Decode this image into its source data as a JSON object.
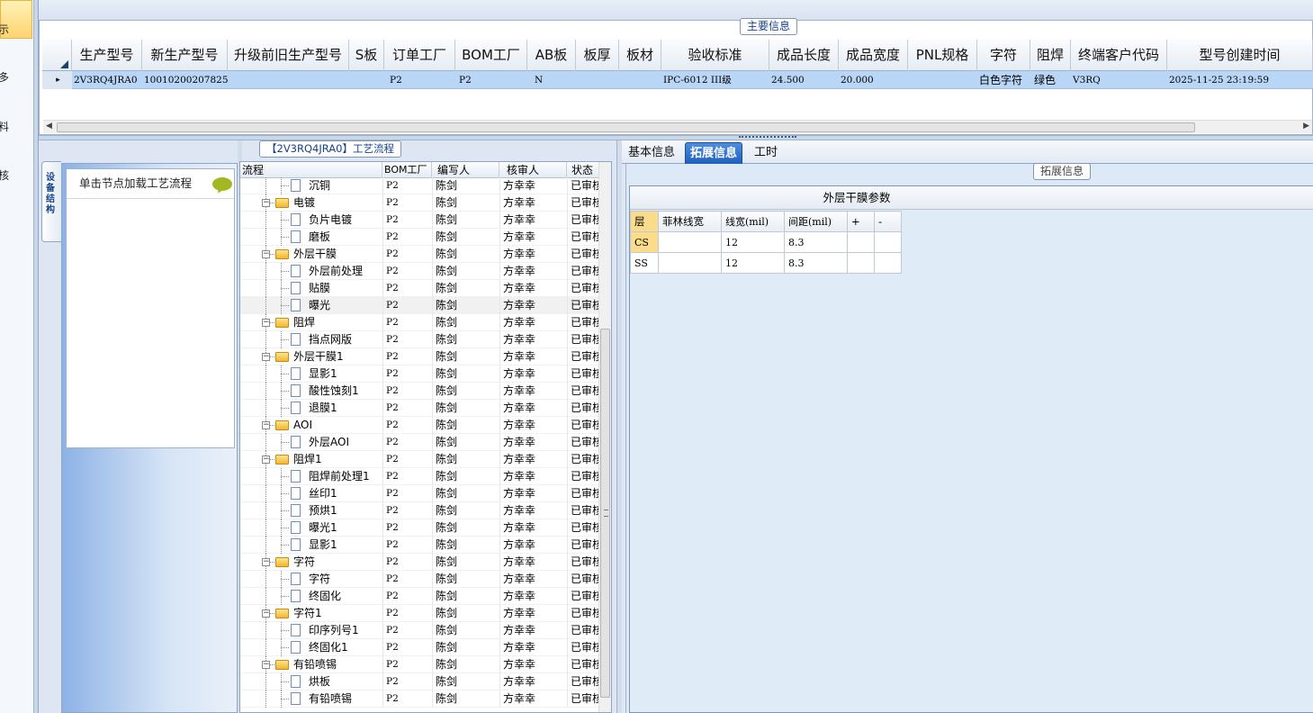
{
  "nav": {
    "items": [
      "示",
      "多",
      "料",
      "核"
    ]
  },
  "main_info": {
    "group_title": "主要信息",
    "columns": [
      "生产型号",
      "新生产型号",
      "升级前旧生产型号",
      "S板",
      "订单工厂",
      "BOM工厂",
      "AB板",
      "板厚",
      "板材",
      "验收标准",
      "成品长度",
      "成品宽度",
      "PNL规格",
      "字符",
      "阻焊",
      "终端客户代码",
      "型号创建时间"
    ],
    "row": {
      "indicator": "▸",
      "cells": [
        "2V3RQ4JRA0",
        "10010200207825",
        "",
        "",
        "P2",
        "P2",
        "N",
        "",
        "",
        "IPC-6012 III级",
        "24.500",
        "20.000",
        "",
        "白色字符",
        "绿色",
        "V3RQ",
        "2025-11-25 23:19:59"
      ]
    }
  },
  "side": {
    "tab_label": "设备结构",
    "load_hint": "单击节点加载工艺流程"
  },
  "process": {
    "group_title": "【2V3RQ4JRA0】工艺流程",
    "columns": [
      "流程",
      "BOM工厂",
      "编写人",
      "核审人",
      "状态"
    ],
    "rows": [
      {
        "name": "沉铜",
        "level": 1,
        "factory": "P2",
        "writer": "陈剑",
        "reviewer": "方幸幸",
        "status": "已审核"
      },
      {
        "name": "电镀",
        "level": 0,
        "factory": "P2",
        "writer": "陈剑",
        "reviewer": "方幸幸",
        "status": "已审核"
      },
      {
        "name": "负片电镀",
        "level": 1,
        "factory": "P2",
        "writer": "陈剑",
        "reviewer": "方幸幸",
        "status": "已审核"
      },
      {
        "name": "磨板",
        "level": 1,
        "factory": "P2",
        "writer": "陈剑",
        "reviewer": "方幸幸",
        "status": "已审核"
      },
      {
        "name": "外层干膜",
        "level": 0,
        "factory": "P2",
        "writer": "陈剑",
        "reviewer": "方幸幸",
        "status": "已审核"
      },
      {
        "name": "外层前处理",
        "level": 1,
        "factory": "P2",
        "writer": "陈剑",
        "reviewer": "方幸幸",
        "status": "已审核"
      },
      {
        "name": "贴膜",
        "level": 1,
        "factory": "P2",
        "writer": "陈剑",
        "reviewer": "方幸幸",
        "status": "已审核"
      },
      {
        "name": "曝光",
        "level": 1,
        "factory": "P2",
        "writer": "陈剑",
        "reviewer": "方幸幸",
        "status": "已审核",
        "highlight": true
      },
      {
        "name": "阻焊",
        "level": 0,
        "factory": "P2",
        "writer": "陈剑",
        "reviewer": "方幸幸",
        "status": "已审核"
      },
      {
        "name": "挡点网版",
        "level": 1,
        "factory": "P2",
        "writer": "陈剑",
        "reviewer": "方幸幸",
        "status": "已审核"
      },
      {
        "name": "外层干膜1",
        "level": 0,
        "factory": "P2",
        "writer": "陈剑",
        "reviewer": "方幸幸",
        "status": "已审核"
      },
      {
        "name": "显影1",
        "level": 1,
        "factory": "P2",
        "writer": "陈剑",
        "reviewer": "方幸幸",
        "status": "已审核"
      },
      {
        "name": "酸性蚀刻1",
        "level": 1,
        "factory": "P2",
        "writer": "陈剑",
        "reviewer": "方幸幸",
        "status": "已审核"
      },
      {
        "name": "退膜1",
        "level": 1,
        "factory": "P2",
        "writer": "陈剑",
        "reviewer": "方幸幸",
        "status": "已审核"
      },
      {
        "name": "AOI",
        "level": 0,
        "factory": "P2",
        "writer": "陈剑",
        "reviewer": "方幸幸",
        "status": "已审核"
      },
      {
        "name": "外层AOI",
        "level": 1,
        "factory": "P2",
        "writer": "陈剑",
        "reviewer": "方幸幸",
        "status": "已审核"
      },
      {
        "name": "阻焊1",
        "level": 0,
        "factory": "P2",
        "writer": "陈剑",
        "reviewer": "方幸幸",
        "status": "已审核"
      },
      {
        "name": "阻焊前处理1",
        "level": 1,
        "factory": "P2",
        "writer": "陈剑",
        "reviewer": "方幸幸",
        "status": "已审核"
      },
      {
        "name": "丝印1",
        "level": 1,
        "factory": "P2",
        "writer": "陈剑",
        "reviewer": "方幸幸",
        "status": "已审核"
      },
      {
        "name": "预烘1",
        "level": 1,
        "factory": "P2",
        "writer": "陈剑",
        "reviewer": "方幸幸",
        "status": "已审核"
      },
      {
        "name": "曝光1",
        "level": 1,
        "factory": "P2",
        "writer": "陈剑",
        "reviewer": "方幸幸",
        "status": "已审核"
      },
      {
        "name": "显影1",
        "level": 1,
        "factory": "P2",
        "writer": "陈剑",
        "reviewer": "方幸幸",
        "status": "已审核"
      },
      {
        "name": "字符",
        "level": 0,
        "factory": "P2",
        "writer": "陈剑",
        "reviewer": "方幸幸",
        "status": "已审核"
      },
      {
        "name": "字符",
        "level": 1,
        "factory": "P2",
        "writer": "陈剑",
        "reviewer": "方幸幸",
        "status": "已审核"
      },
      {
        "name": "终固化",
        "level": 1,
        "factory": "P2",
        "writer": "陈剑",
        "reviewer": "方幸幸",
        "status": "已审核"
      },
      {
        "name": "字符1",
        "level": 0,
        "factory": "P2",
        "writer": "陈剑",
        "reviewer": "方幸幸",
        "status": "已审核"
      },
      {
        "name": "印序列号1",
        "level": 1,
        "factory": "P2",
        "writer": "陈剑",
        "reviewer": "方幸幸",
        "status": "已审核"
      },
      {
        "name": "终固化1",
        "level": 1,
        "factory": "P2",
        "writer": "陈剑",
        "reviewer": "方幸幸",
        "status": "已审核"
      },
      {
        "name": "有铅喷锡",
        "level": 0,
        "factory": "P2",
        "writer": "陈剑",
        "reviewer": "方幸幸",
        "status": "已审核"
      },
      {
        "name": "烘板",
        "level": 1,
        "factory": "P2",
        "writer": "陈剑",
        "reviewer": "方幸幸",
        "status": "已审核"
      },
      {
        "name": "有铅喷锡",
        "level": 1,
        "factory": "P2",
        "writer": "陈剑",
        "reviewer": "方幸幸",
        "status": "已审核"
      }
    ]
  },
  "right_tabs": {
    "basic": "基本信息",
    "extended": "拓展信息",
    "hours": "工时"
  },
  "extended": {
    "group_title": "拓展信息",
    "param_title": "外层干膜参数",
    "columns": [
      "层",
      "菲林线宽",
      "线宽(mil)",
      "间距(mil)",
      "+",
      "-"
    ],
    "rows": [
      {
        "layer": "CS",
        "film": "",
        "width": "12",
        "spacing": "8.3"
      },
      {
        "layer": "SS",
        "film": "",
        "width": "12",
        "spacing": "8.3"
      }
    ]
  },
  "colors": {
    "selected_row": "#b9d6f7",
    "active_tab": "#1f5fbf",
    "selected_cell": "#fbdc8a",
    "folder": "#f2b632"
  }
}
